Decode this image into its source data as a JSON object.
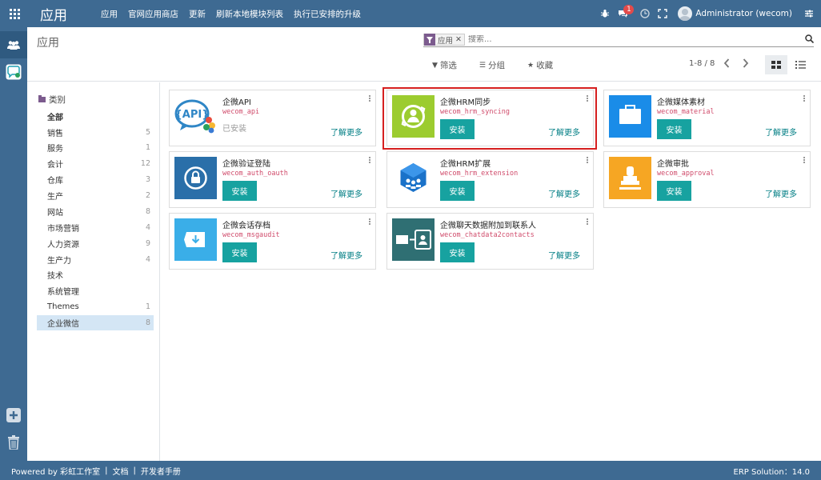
{
  "brand": "应用",
  "topmenu": [
    "应用",
    "官网应用商店",
    "更新",
    "刷新本地模块列表",
    "执行已安排的升级"
  ],
  "notifications": {
    "chat_count": "1"
  },
  "user": {
    "name": "Administrator (wecom)"
  },
  "page_title": "应用",
  "search": {
    "facet_value": "应用",
    "placeholder": "搜索..."
  },
  "filters": {
    "filter": "筛选",
    "group": "分组",
    "favorites": "收藏"
  },
  "pager": "1-8 / 8",
  "categories": {
    "header": "类别",
    "items": [
      {
        "name": "全部",
        "count": ""
      },
      {
        "name": "销售",
        "count": "5"
      },
      {
        "name": "服务",
        "count": "1"
      },
      {
        "name": "会计",
        "count": "12"
      },
      {
        "name": "仓库",
        "count": "3"
      },
      {
        "name": "生产",
        "count": "2"
      },
      {
        "name": "网站",
        "count": "8"
      },
      {
        "name": "市场营销",
        "count": "4"
      },
      {
        "name": "人力资源",
        "count": "9"
      },
      {
        "name": "生产力",
        "count": "4"
      },
      {
        "name": "技术",
        "count": ""
      },
      {
        "name": "系统管理",
        "count": ""
      },
      {
        "name": "Themes",
        "count": "1"
      },
      {
        "name": "企业微信",
        "count": "8"
      }
    ]
  },
  "apps": [
    {
      "title": "企微API",
      "tech": "wecom_api",
      "status": "已安装",
      "learn": "了解更多"
    },
    {
      "title": "企微HRM同步",
      "tech": "wecom_hrm_syncing",
      "install": "安装",
      "learn": "了解更多"
    },
    {
      "title": "企微媒体素材",
      "tech": "wecom_material",
      "install": "安装",
      "learn": "了解更多"
    },
    {
      "title": "企微验证登陆",
      "tech": "wecom_auth_oauth",
      "install": "安装",
      "learn": "了解更多"
    },
    {
      "title": "企微HRM扩展",
      "tech": "wecom_hrm_extension",
      "install": "安装",
      "learn": "了解更多"
    },
    {
      "title": "企微审批",
      "tech": "wecom_approval",
      "install": "安装",
      "learn": "了解更多"
    },
    {
      "title": "企微会话存档",
      "tech": "wecom_msgaudit",
      "install": "安装",
      "learn": "了解更多"
    },
    {
      "title": "企微聊天数据附加到联系人",
      "tech": "wecom_chatdata2contacts",
      "install": "安装",
      "learn": "了解更多"
    }
  ],
  "footer": {
    "powered": "Powered by 彩虹工作室",
    "docs": "文档",
    "devguide": "开发者手册",
    "version": "ERP Solution：14.0"
  },
  "colors": {
    "navbar": "#3e6a92",
    "install_button": "#17a2a0",
    "tech_name": "#d04b6b",
    "highlight": "#d61f1f"
  }
}
